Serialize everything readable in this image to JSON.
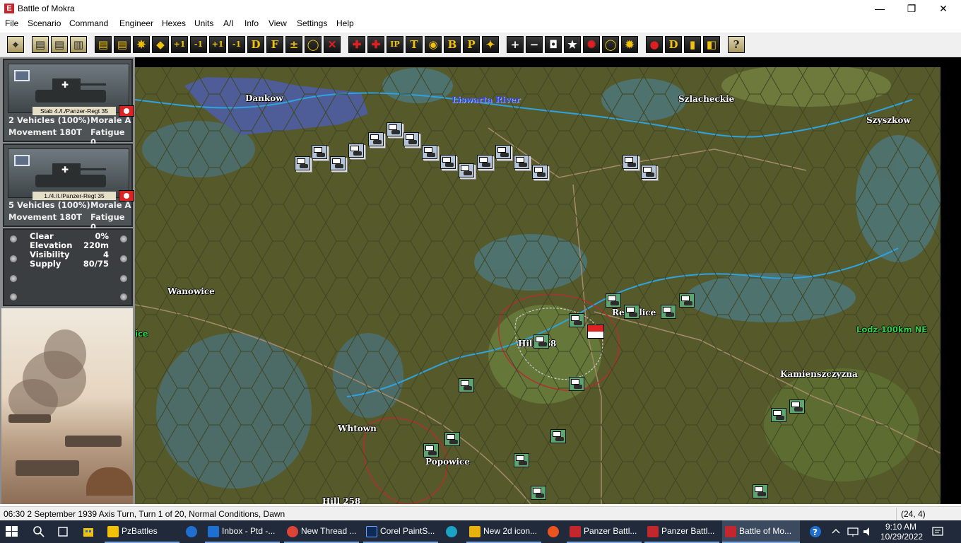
{
  "window": {
    "title": "Battle of Mokra",
    "minimize": "—",
    "maximize": "❐",
    "close": "✕"
  },
  "menu": [
    "File",
    "Scenario",
    "Command",
    "Engineer",
    "Hexes",
    "Units",
    "A/I",
    "Info",
    "View",
    "Settings",
    "Help"
  ],
  "toolbar": {
    "buttons": [
      "⌖",
      "▤",
      "▤",
      "▥",
      "▤",
      "▤",
      "✵",
      "◆",
      "+1",
      "-1",
      "+1",
      "-1",
      "D",
      "F",
      "±",
      "◯",
      "✕",
      "✚",
      "✚",
      "IP",
      "T",
      "◉",
      "B",
      "P",
      "✦",
      "+",
      "−",
      "◘",
      "★",
      "✺",
      "◯",
      "✹",
      "●",
      "D",
      "▮",
      "◧",
      "?"
    ]
  },
  "units": [
    {
      "name": "Stab 4./I./Panzer-Regt 35",
      "vehicles": "2 Vehicles (100%)",
      "morale": "Morale A",
      "movement": "Movement 180T",
      "fatigue": "Fatigue 0"
    },
    {
      "name": "1./4./I./Panzer-Regt 35",
      "vehicles": "5 Vehicles (100%)",
      "morale": "Morale A",
      "movement": "Movement 180T",
      "fatigue": "Fatigue 0"
    }
  ],
  "terrain": {
    "rows": [
      {
        "label": "Clear",
        "value": "0%"
      },
      {
        "label": "Elevation",
        "value": "220m"
      },
      {
        "label": "Visibility",
        "value": "4"
      },
      {
        "label": "Supply",
        "value": "80/75"
      }
    ]
  },
  "map": {
    "labels": {
      "dankow": "Dankow",
      "liswarta": "Liswarta River",
      "szlacheckie": "Szlacheckie",
      "szyszkow": "Szyszkow",
      "wanowice": "Wanowice",
      "ice": "ice",
      "rebielice": "Rebielice",
      "hill268": "Hill 268",
      "lodz": "Lodz-100km NE",
      "kamienszczyzna": "Kamienszczyzna",
      "whtown": "Whtown",
      "popowice": "Popowice",
      "hill258": "Hill 258"
    }
  },
  "status": {
    "text": "06:30 2 September 1939 Axis Turn, Turn 1 of 20, Normal Conditions, Dawn",
    "coord": "(24, 4)"
  },
  "taskbar": {
    "tasks": [
      "PzBattles",
      "Inbox - Ptd -...",
      "New Thread ...",
      "Corel PaintS...",
      "New 2d icon...",
      "Panzer Battl...",
      "Panzer Battl...",
      "Battle of Mo..."
    ],
    "time": "9:10 AM",
    "date": "10/29/2022"
  }
}
